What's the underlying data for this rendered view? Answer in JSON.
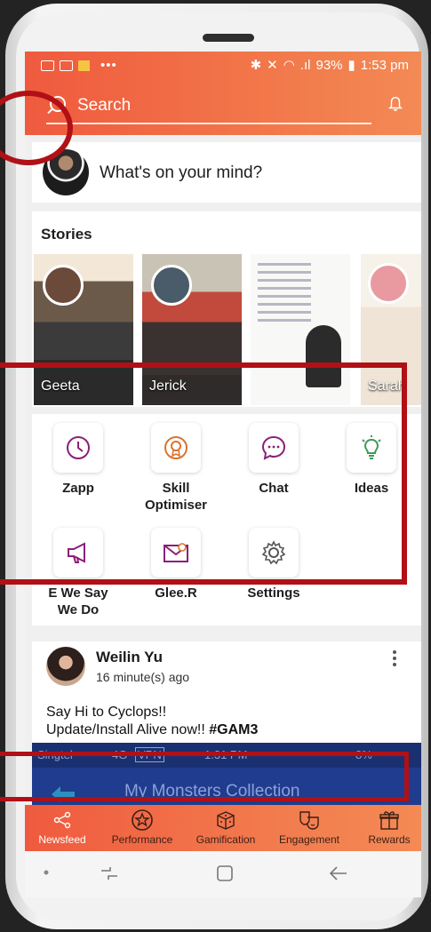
{
  "status": {
    "time": "1:53 pm",
    "battery": "93%"
  },
  "search": {
    "placeholder": "Search"
  },
  "composer": {
    "prompt": "What's on your mind?"
  },
  "stories": {
    "title": "Stories",
    "items": [
      {
        "name": "Geeta"
      },
      {
        "name": "Jerick"
      },
      {
        "name": ""
      },
      {
        "name": "Sarah"
      }
    ]
  },
  "shortcuts": [
    {
      "label": "Zapp",
      "icon": "clock-icon"
    },
    {
      "label": "Skill Optimiser",
      "icon": "award-icon"
    },
    {
      "label": "Chat",
      "icon": "chat-bubble-icon"
    },
    {
      "label": "Ideas",
      "icon": "lightbulb-icon"
    },
    {
      "label": "E We Say We Do",
      "icon": "megaphone-icon"
    },
    {
      "label": "Glee.R",
      "icon": "envelope-icon"
    },
    {
      "label": "Settings",
      "icon": "gear-icon"
    }
  ],
  "post": {
    "author": "Weilin Yu",
    "time": "16 minute(s) ago",
    "line1": "Say Hi to Cyclops!!",
    "line2_prefix": "Update/Install Alive now!! ",
    "line2_tag": "#GAM3",
    "image": {
      "carrier": "Singtel",
      "network": "4G",
      "vpn": "VPN",
      "time": "1:31 PM",
      "battery": "8%",
      "title": "My Monsters Collection"
    }
  },
  "bottom_nav": [
    {
      "label": "Newsfeed",
      "icon": "share-icon"
    },
    {
      "label": "Performance",
      "icon": "star-badge-icon"
    },
    {
      "label": "Gamification",
      "icon": "dice-icon"
    },
    {
      "label": "Engagement",
      "icon": "masks-icon"
    },
    {
      "label": "Rewards",
      "icon": "gift-icon"
    }
  ],
  "colors": {
    "accent": "#f06a45",
    "highlight": "#b01016",
    "icon_purple": "#8b1f7a",
    "icon_orange": "#d9742c",
    "icon_green": "#3f9a5a"
  }
}
